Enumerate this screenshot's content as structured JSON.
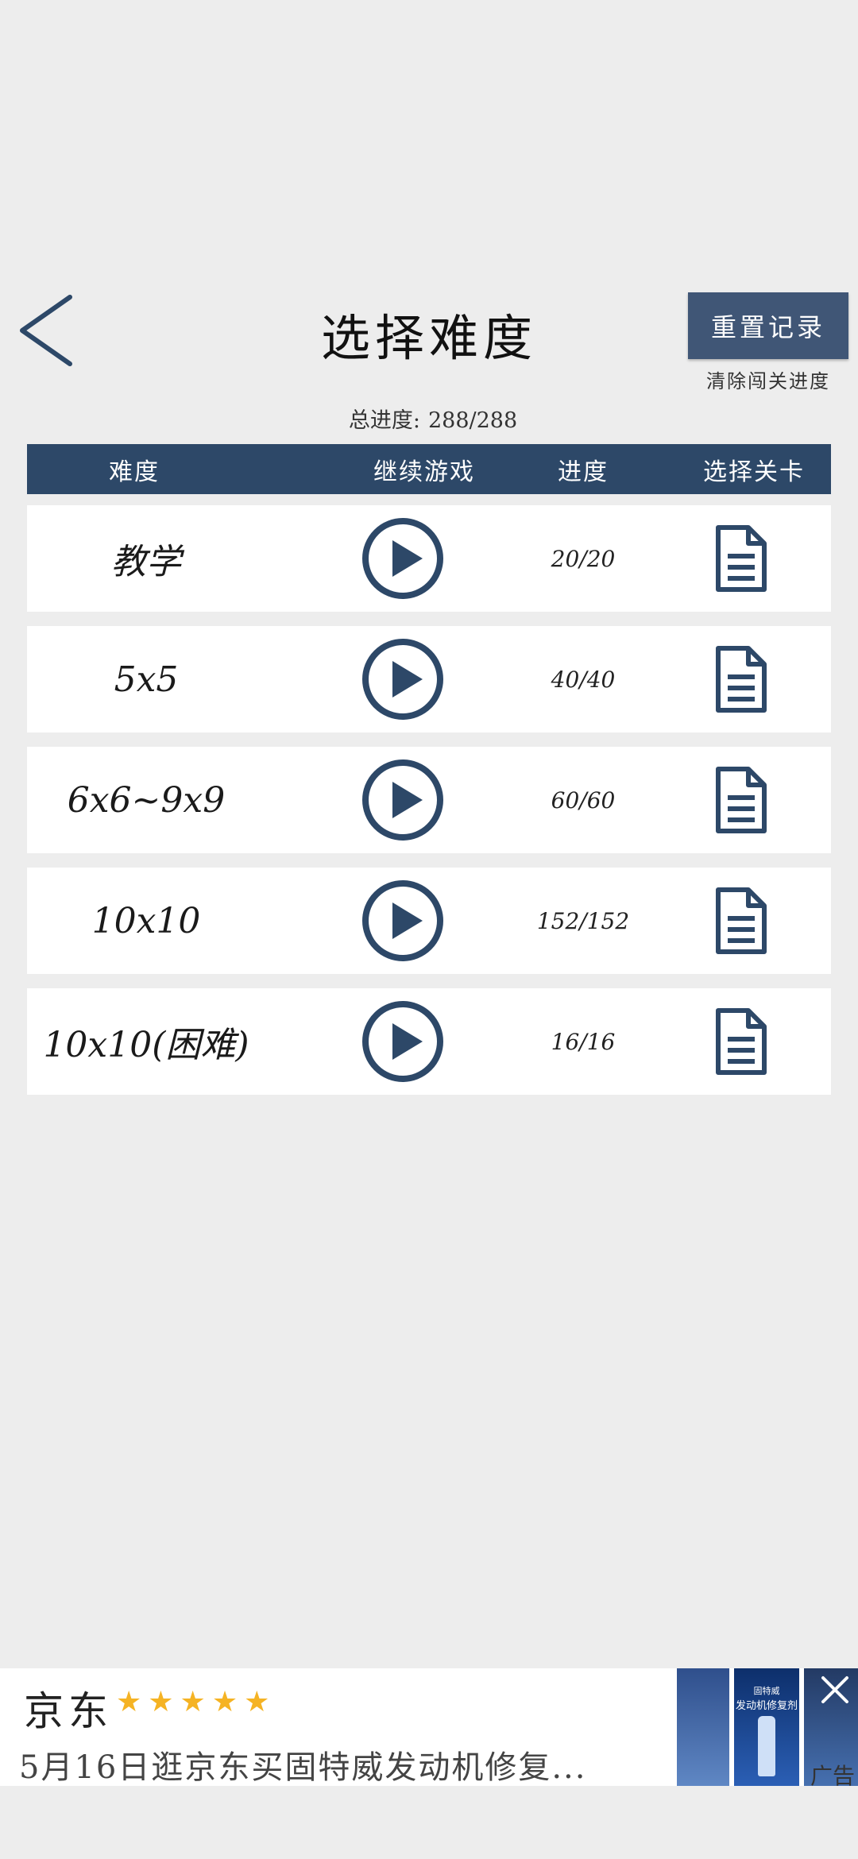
{
  "header": {
    "title": "选择难度",
    "reset_label": "重置记录",
    "reset_note": "清除闯关进度",
    "total_label": "总进度:",
    "total_value": "288/288"
  },
  "table": {
    "columns": [
      "难度",
      "继续游戏",
      "进度",
      "选择关卡"
    ],
    "rows": [
      {
        "name": "教学",
        "progress": "20/20"
      },
      {
        "name": "5x5",
        "progress": "40/40"
      },
      {
        "name": "6x6~9x9",
        "progress": "60/60"
      },
      {
        "name": "10x10",
        "progress": "152/152"
      },
      {
        "name": "10x10(困难)",
        "progress": "16/16"
      }
    ]
  },
  "ad": {
    "brand": "京东",
    "stars": "★★★★★",
    "text": "5月16日逛京东买固特威发动机修复...",
    "image_caption_1": "固特威",
    "image_caption_2": "发动机修复剂",
    "label": "广告"
  },
  "colors": {
    "accent": "#2d4868",
    "button": "#405676",
    "background": "#ededed",
    "stars": "#f5b324"
  }
}
